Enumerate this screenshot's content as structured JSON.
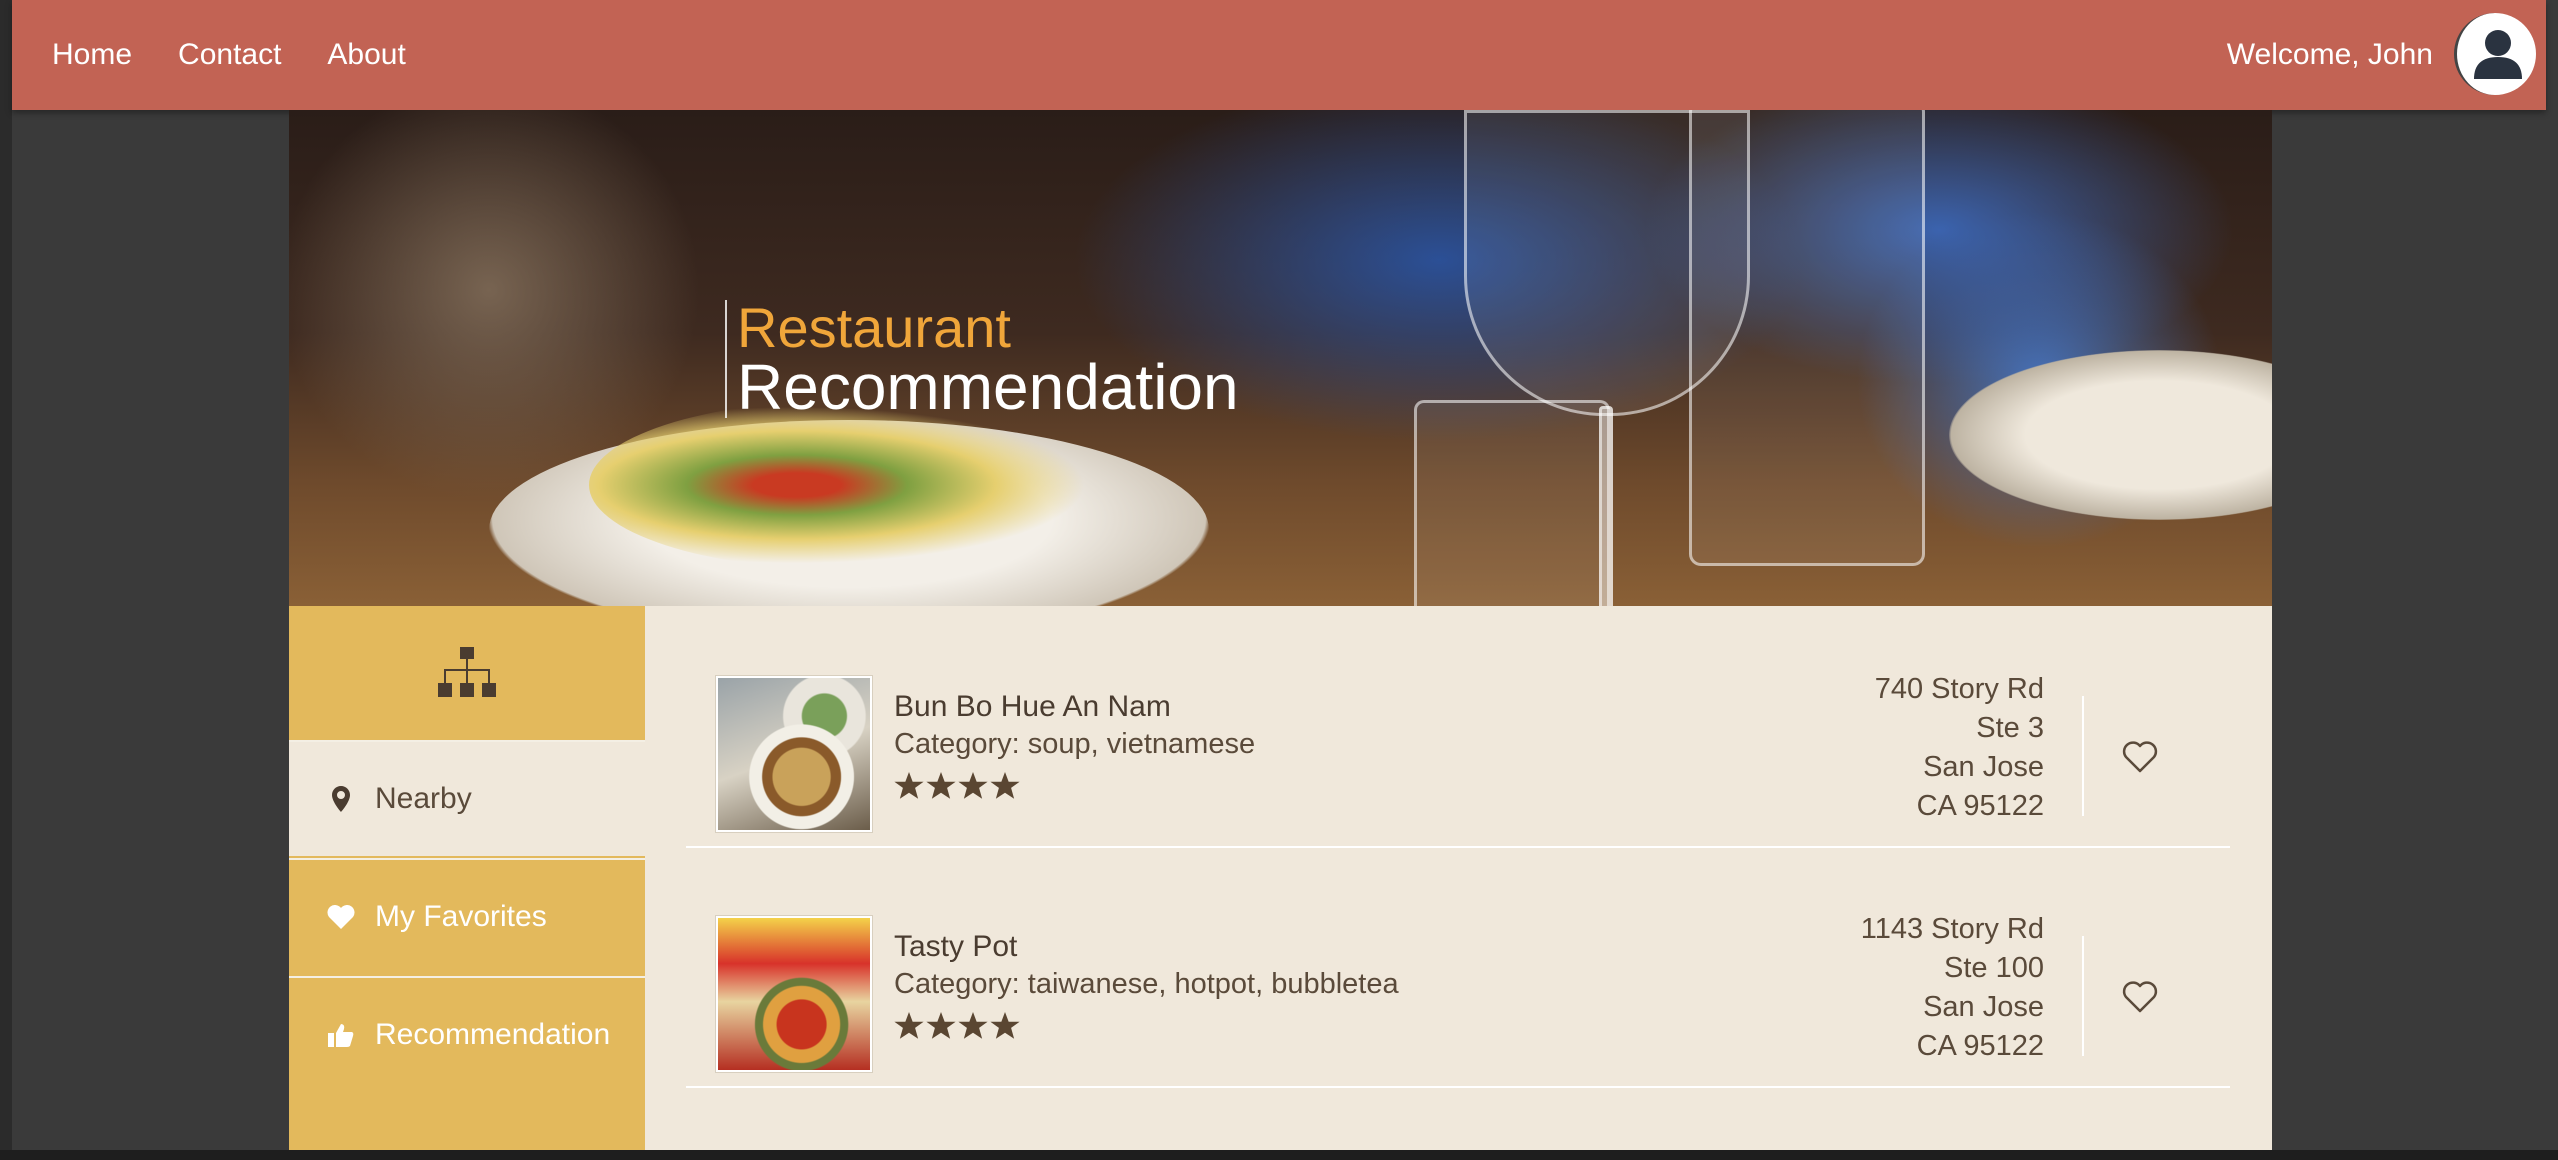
{
  "nav": {
    "links": [
      "Home",
      "Contact",
      "About"
    ],
    "welcome": "Welcome, John"
  },
  "banner": {
    "title_line1": "Restaurant",
    "title_line2": "Recommendation"
  },
  "sidebar": {
    "items": [
      {
        "label": "Nearby",
        "icon": "map-marker-icon"
      },
      {
        "label": "My Favorites",
        "icon": "heart-icon"
      },
      {
        "label": "Recommendation",
        "icon": "thumbs-up-icon"
      }
    ]
  },
  "restaurants": [
    {
      "name": "Bun Bo Hue An Nam",
      "category": "Category: soup, vietnamese",
      "rating": 4,
      "address": [
        "740 Story Rd",
        "Ste 3",
        "San Jose",
        "CA 95122"
      ]
    },
    {
      "name": "Tasty Pot",
      "category": "Category: taiwanese, hotpot, bubbletea",
      "rating": 4,
      "address": [
        "1143 Story Rd",
        "Ste 100",
        "San Jose",
        "CA 95122"
      ]
    }
  ],
  "colors": {
    "topbar": "#c26354",
    "sidebar": "#e3b95c",
    "content_bg": "#f0e8db",
    "title_accent": "#f0a63a",
    "text_dark": "#5a4a3a"
  }
}
